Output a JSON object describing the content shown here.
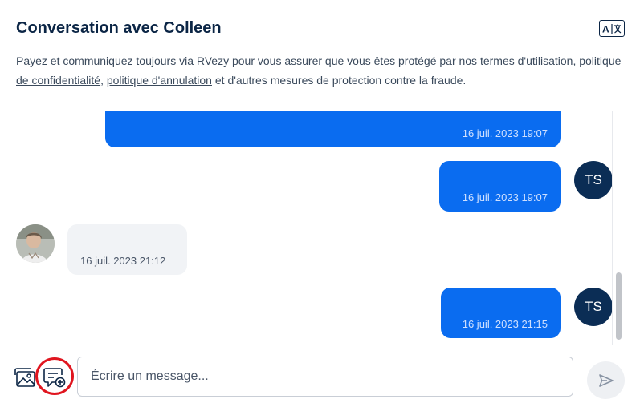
{
  "header": {
    "title": "Conversation avec Colleen",
    "translate_icon": "translate-icon"
  },
  "notice": {
    "text_before": "Payez et communiquez toujours via RVezy pour vous assurer que vous êtes protégé par nos ",
    "link_terms": "termes d'utilisation",
    "sep1": ",",
    "link_privacy": "politique de confidentialité",
    "sep2": ", ",
    "link_cancellation": "politique d'annulation",
    "text_after": " et d'autres mesures de protection contre la fraude."
  },
  "messages": [
    {
      "direction": "outgoing",
      "time": "16 juil. 2023 19:07"
    },
    {
      "direction": "outgoing",
      "time": "16 juil. 2023 19:07",
      "avatar_initials": "TS"
    },
    {
      "direction": "incoming",
      "time": "16 juil. 2023 21:12",
      "avatar": "colleen-photo"
    },
    {
      "direction": "outgoing",
      "time": "16 juil. 2023 21:15",
      "avatar_initials": "TS"
    }
  ],
  "composer": {
    "placeholder": "Écrire un message...",
    "image_icon": "image-icon",
    "template_icon": "message-template-icon",
    "send_icon": "send-icon"
  },
  "colors": {
    "primary_navy": "#0b2545",
    "bubble_out": "#0a6cf0",
    "bubble_in": "#f1f3f6",
    "highlight": "#e0151f"
  }
}
